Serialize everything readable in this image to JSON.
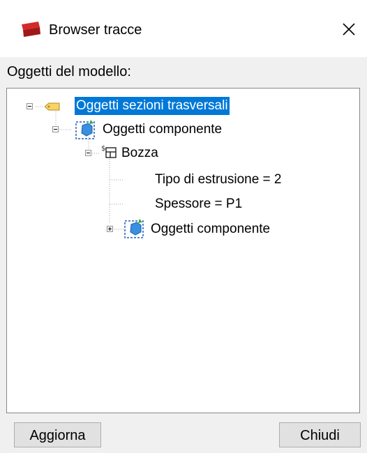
{
  "window": {
    "title": "Browser tracce",
    "close_glyph": "✕"
  },
  "panel": {
    "label": "Oggetti del modello:"
  },
  "tree": {
    "nodes": [
      {
        "label": "Oggetti sezioni trasversali",
        "icon": "tag-icon",
        "expander": "collapse",
        "selected": true
      },
      {
        "label": "Oggetti componente",
        "icon": "component-objects-icon",
        "expander": "collapse"
      },
      {
        "label": "Bozza",
        "icon": "sketch-icon",
        "expander": "collapse"
      },
      {
        "label": "Tipo di estrusione = 2"
      },
      {
        "label": "Spessore = P1"
      },
      {
        "label": "Oggetti componente",
        "icon": "component-objects-icon",
        "expander": "expand"
      }
    ]
  },
  "buttons": {
    "refresh": "Aggiorna",
    "close": "Chiudi"
  },
  "colors": {
    "selection": "#0078d7",
    "window_bg": "#f0f0f0",
    "tree_border": "#828790"
  }
}
